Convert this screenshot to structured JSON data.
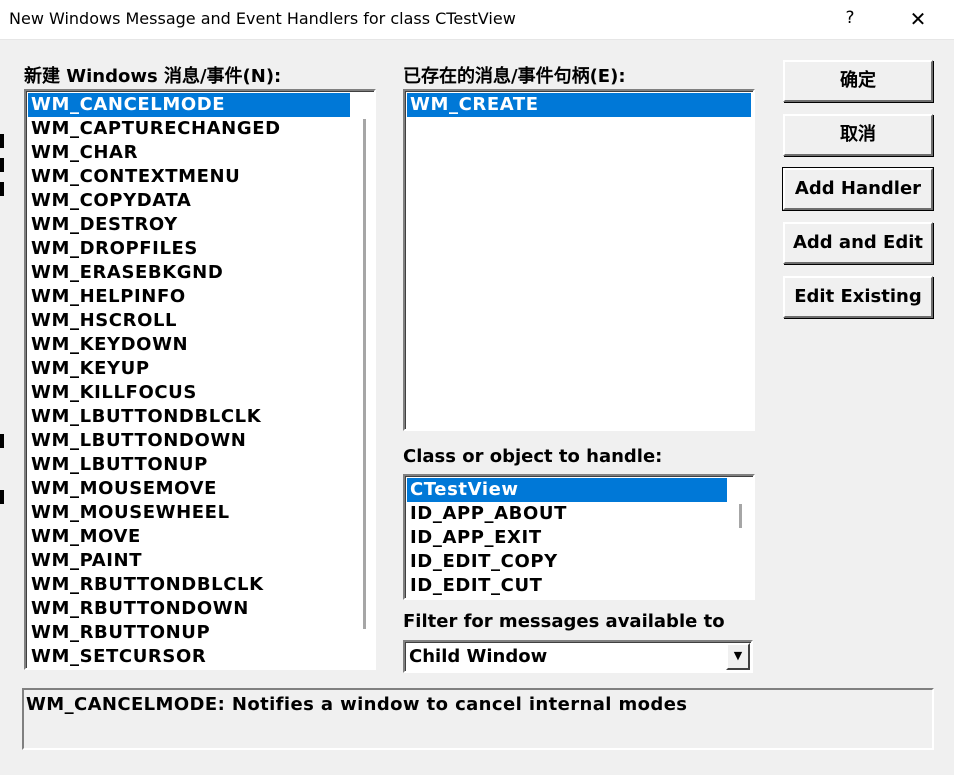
{
  "window": {
    "title": "New Windows Message and Event Handlers for class CTestView",
    "help_glyph": "?",
    "close_glyph": "✕"
  },
  "new_messages": {
    "label": "新建 Windows 消息/事件(N):",
    "items": [
      "WM_CANCELMODE",
      "WM_CAPTURECHANGED",
      "WM_CHAR",
      "WM_CONTEXTMENU",
      "WM_COPYDATA",
      "WM_DESTROY",
      "WM_DROPFILES",
      "WM_ERASEBKGND",
      "WM_HELPINFO",
      "WM_HSCROLL",
      "WM_KEYDOWN",
      "WM_KEYUP",
      "WM_KILLFOCUS",
      "WM_LBUTTONDBLCLK",
      "WM_LBUTTONDOWN",
      "WM_LBUTTONUP",
      "WM_MOUSEMOVE",
      "WM_MOUSEWHEEL",
      "WM_MOVE",
      "WM_PAINT",
      "WM_RBUTTONDBLCLK",
      "WM_RBUTTONDOWN",
      "WM_RBUTTONUP",
      "WM_SETCURSOR"
    ],
    "selected": "WM_CANCELMODE"
  },
  "existing_handlers": {
    "label": "已存在的消息/事件句柄(E):",
    "items": [
      "WM_CREATE"
    ],
    "selected": "WM_CREATE"
  },
  "class_object": {
    "label": "Class or object to handle:",
    "items": [
      "CTestView",
      "ID_APP_ABOUT",
      "ID_APP_EXIT",
      "ID_EDIT_COPY",
      "ID_EDIT_CUT"
    ],
    "selected": "CTestView"
  },
  "filter": {
    "label": "Filter for messages available to",
    "value": "Child Window",
    "arrow_glyph": "▼"
  },
  "buttons": {
    "ok": "确定",
    "cancel": "取消",
    "add_handler": "Add Handler",
    "add_and_edit": "Add and Edit",
    "edit_existing": "Edit Existing"
  },
  "description": "WM_CANCELMODE:  Notifies a window to cancel internal modes",
  "colors": {
    "selection": "#0078d7",
    "dialog_bg": "#f0f0f0"
  }
}
